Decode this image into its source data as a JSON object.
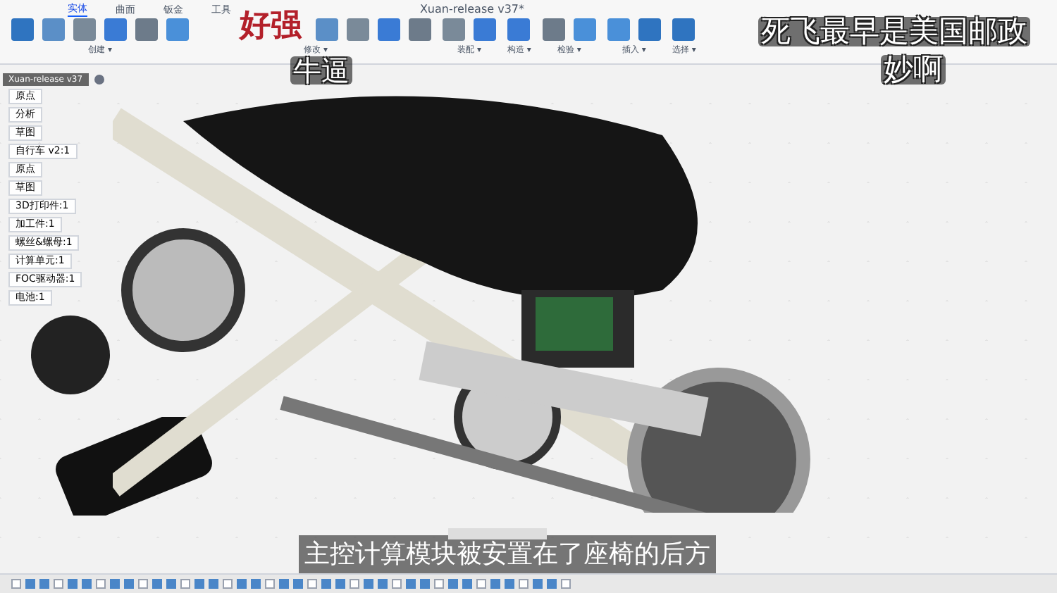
{
  "window": {
    "title": "Xuan-release v37*"
  },
  "tabs": [
    {
      "label": "实体",
      "selected": true
    },
    {
      "label": "曲面",
      "selected": false
    },
    {
      "label": "钣金",
      "selected": false
    },
    {
      "label": "工具",
      "selected": false
    }
  ],
  "tool_groups": [
    {
      "label": "创建 ▾"
    },
    {
      "label": "修改 ▾"
    },
    {
      "label": "装配 ▾"
    },
    {
      "label": "构造 ▾"
    },
    {
      "label": "检验 ▾"
    },
    {
      "label": "插入 ▾"
    },
    {
      "label": "选择 ▾"
    }
  ],
  "browser": {
    "title": "Xuan-release v37",
    "items": [
      {
        "label": "原点"
      },
      {
        "label": "分析"
      },
      {
        "label": "草图"
      },
      {
        "label": "自行车 v2:1"
      },
      {
        "label": "原点"
      },
      {
        "label": "草图"
      },
      {
        "label": "3D打印件:1"
      },
      {
        "label": "加工件:1"
      },
      {
        "label": "螺丝&螺母:1"
      },
      {
        "label": "计算单元:1"
      },
      {
        "label": "FOC驱动器:1"
      },
      {
        "label": "电池:1"
      }
    ]
  },
  "danmaku": [
    {
      "text": "好强",
      "kind": "red"
    },
    {
      "text": "牛逼",
      "kind": "white"
    },
    {
      "text": "死飞最早是美国邮政",
      "kind": "white"
    },
    {
      "text": "妙啊",
      "kind": "white"
    }
  ],
  "subtitle": "主控计算模块被安置在了座椅的后方"
}
